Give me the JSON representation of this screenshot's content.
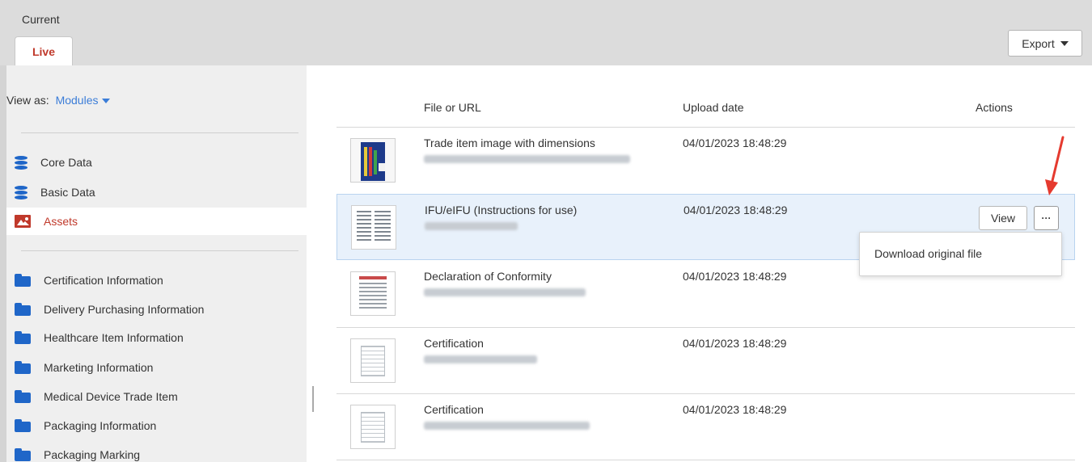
{
  "header": {
    "title": "Current",
    "tab_live": "Live",
    "export_label": "Export"
  },
  "sidebar": {
    "view_as_label": "View as:",
    "view_as_value": "Modules",
    "top_items": [
      {
        "label": "Core Data",
        "icon": "database-icon"
      },
      {
        "label": "Basic Data",
        "icon": "database-icon"
      },
      {
        "label": "Assets",
        "icon": "image-icon",
        "active": true
      }
    ],
    "folders": [
      {
        "label": "Certification Information"
      },
      {
        "label": "Delivery Purchasing Information"
      },
      {
        "label": "Healthcare Item Information"
      },
      {
        "label": "Marketing Information"
      },
      {
        "label": "Medical Device Trade Item"
      },
      {
        "label": "Packaging Information"
      },
      {
        "label": "Packaging Marking"
      }
    ]
  },
  "table": {
    "columns": [
      "File or URL",
      "Upload date",
      "Actions"
    ],
    "rows": [
      {
        "title": "Trade item image with dimensions",
        "date": "04/01/2023 18:48:29"
      },
      {
        "title": "IFU/eIFU (Instructions for use)",
        "date": "04/01/2023 18:48:29",
        "selected": true
      },
      {
        "title": "Declaration of Conformity",
        "date": "04/01/2023 18:48:29"
      },
      {
        "title": "Certification",
        "date": "04/01/2023 18:48:29"
      },
      {
        "title": "Certification",
        "date": "04/01/2023 18:48:29"
      }
    ],
    "view_label": "View",
    "more_label": "···"
  },
  "dropdown": {
    "item": "Download original file"
  },
  "colors": {
    "accent_red": "#c0392b",
    "link_blue": "#3b7dd8",
    "icon_blue": "#1f66c8",
    "selected_row": "#e8f1fb"
  }
}
